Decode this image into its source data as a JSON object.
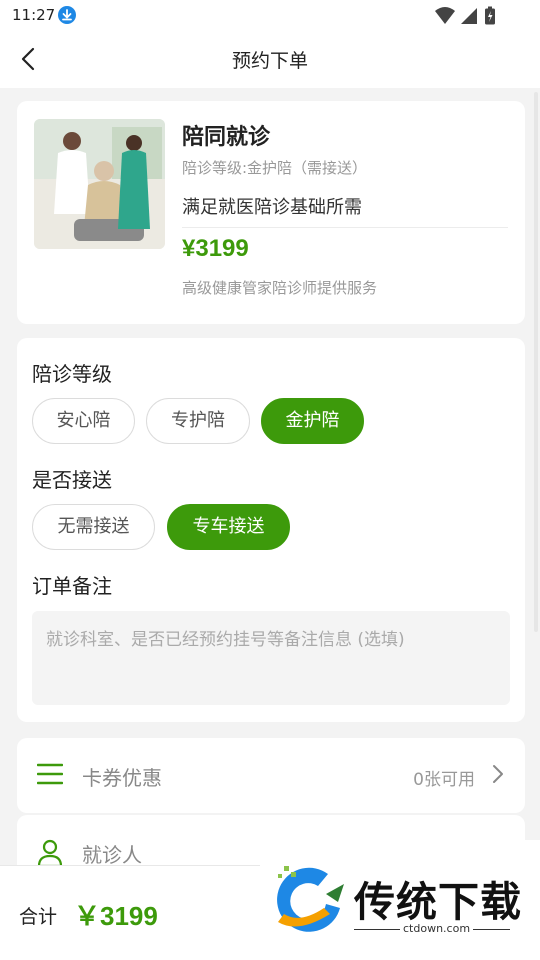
{
  "status_bar": {
    "time": "11:27"
  },
  "nav": {
    "title": "预约下单"
  },
  "product": {
    "title": "陪同就诊",
    "level_text": "陪诊等级:金护陪（需接送）",
    "description": "满足就医陪诊基础所需",
    "price": "¥3199",
    "service_text": "高级健康管家陪诊师提供服务"
  },
  "options": {
    "level_label": "陪诊等级",
    "levels": [
      "安心陪",
      "专护陪",
      "金护陪"
    ],
    "selected_level": "金护陪",
    "pickup_label": "是否接送",
    "pickups": [
      "无需接送",
      "专车接送"
    ],
    "selected_pickup": "专车接送",
    "remark_label": "订单备注",
    "remark_placeholder": "就诊科室、是否已经预约挂号等备注信息 (选填)"
  },
  "coupon": {
    "label": "卡券优惠",
    "count_text": "0张可用"
  },
  "patient": {
    "label": "就诊人"
  },
  "footer": {
    "total_label": "合计",
    "total_amount": "￥3199"
  },
  "watermark": {
    "text": "传统下载",
    "url": "ctdown.com"
  },
  "colors": {
    "accent": "#3d9a0b",
    "background": "#f3f3f3"
  }
}
